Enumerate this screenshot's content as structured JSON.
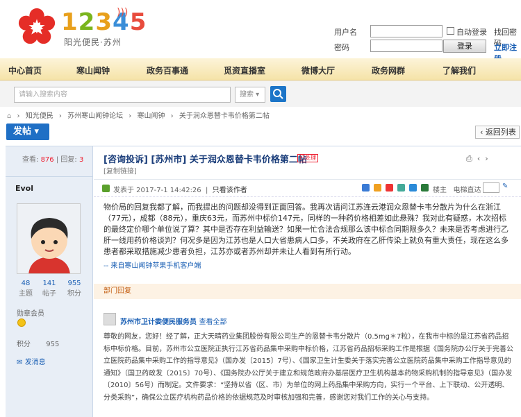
{
  "brand": {
    "number_digits": [
      "1",
      "2",
      "3",
      "4",
      "5"
    ],
    "subtitle": "阳光便民·苏州"
  },
  "login": {
    "username_label": "用户名",
    "password_label": "密码",
    "auto_login_label": "自动登录",
    "login_button": "登录",
    "forgot_password": "找回密码",
    "register": "立即注册"
  },
  "nav": {
    "items": [
      "中心首页",
      "寒山闻钟",
      "政务百事通",
      "觅资直播室",
      "微博大厅",
      "政务网群",
      "了解我们"
    ]
  },
  "search": {
    "placeholder": "请输入搜索内容",
    "scope": "搜索"
  },
  "breadcrumb": [
    "知光便民",
    "苏州寒山闻钟论坛",
    "寒山闻钟",
    "关于润众恩替卡韦价格第二帖"
  ],
  "actions": {
    "post": "发帖",
    "back": "返回列表"
  },
  "thread": {
    "views_label": "查看:",
    "views": "876",
    "replies_label": "回复:",
    "replies": "3",
    "title": "[咨询投诉] [苏州市] 关于润众恩替卡韦价格第二帖",
    "status_tag": "已处理",
    "category_tag": "[复制链接]",
    "posted": "发表于 2017-7-1 14:42:26",
    "author_only": "只看该作者",
    "floor_label": "楼主",
    "jump_label": "电梯直达",
    "body": "物价局的回复我都了解，而我提出的问题却没得到正面回答。我再次请问江苏连云港润众恩替卡韦分散片为什么在浙江（77元），成都（88元），重庆63元，而苏州中标价147元，同样的一种药价格相差如此悬殊？我对此有疑惑，木次招标的最终定价哪个单位说了算？其中是否存在利益输送？如果一忙合法合规那么该中标合同期限多久？未来是否考虑进行乙肝一线用药价格谈判？何况多是因为江苏也是人口大省患病人口多，不关政府在乙肝传染上就负有重大责任，现在这么多患者都采取措施减少患者负担，江苏亦或者苏州却并未让人看到有所行动。",
    "mobile_link": "-- 来自寒山闻钟苹果手机客户端"
  },
  "user": {
    "name": "Evol",
    "stats": [
      {
        "value": "48",
        "label": "主题"
      },
      {
        "value": "141",
        "label": "帖子"
      },
      {
        "value": "955",
        "label": "积分"
      }
    ],
    "medal_label": "勋章会员",
    "points_label": "积分",
    "points": "955",
    "message_link": "发消息"
  },
  "department": {
    "label": "部门回复"
  },
  "reply": {
    "author": "苏州市卫计委便民服务员",
    "view_all": "查看全部",
    "text": "尊敬的网友，您好！经了解，正大天晴药业集团股份有限公司生产的恩替卡韦分散片（0.5mg＊7粒），在我市中标的是江苏省药品招标中标价格。目前，苏州市公立医院正执行江苏省药品集中采购中标价格，江苏省药品招标采购工作是根据《国务院办公厅关于完善公立医院药品集中采购工作的指导意见》（国办发〔2015〕7号）、《国家卫生计生委关于落实完善公立医院药品集中采购工作指导意见的通知》（国卫药政发〔2015〕70号）、《国务院办公厅关于建立和规范政府办基层医疗卫生机构基本药物采购机制的指导意见》（国办发〔2010〕56号）而制定。文件要求：“坚持以省（区、市）为单位的网上药品集中采购方向，实行一个平台、上下联动、公开透明、分类采购”，确保公立医疗机构药品价格的依据规范及时审核加强和完善，感谢您对我们工作的关心与支持。"
  },
  "colors": {
    "nav_bg": "#f5e3a8",
    "primary_blue": "#1f6fc5",
    "accent_red": "#e22233",
    "sidebar_bg": "#e8eef6"
  }
}
